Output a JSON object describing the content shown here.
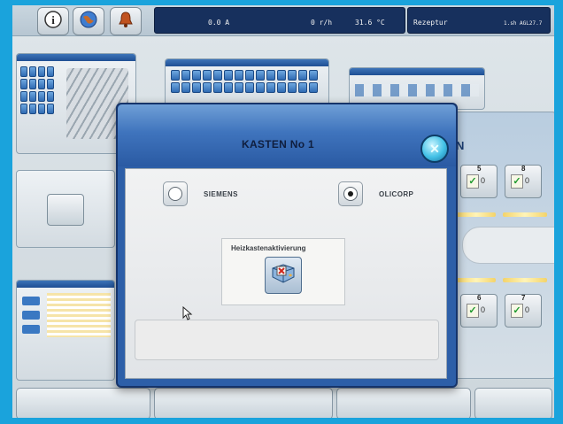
{
  "status_bar": {
    "field_1": "0.0 A",
    "field_2": "0 r/h",
    "field_3": "31.6 °C",
    "field_4": "Rezeptur",
    "field_5": "1.sh AGL27.7"
  },
  "dialog": {
    "title": "KASTEN No 1",
    "options": [
      {
        "label": "SIEMENS",
        "selected": false
      },
      {
        "label": "OLICORP",
        "selected": true
      }
    ],
    "heiz_label": "Heizkastenaktivierung",
    "message": ""
  },
  "background": {
    "partial_letter": "N",
    "tiles": [
      {
        "num": "5",
        "value": "0"
      },
      {
        "num": "8",
        "value": "0"
      },
      {
        "num": "6",
        "value": "0"
      },
      {
        "num": "7",
        "value": "0"
      }
    ]
  },
  "icons": {
    "info": "info-icon",
    "globe": "globe-icon",
    "bell": "bell-icon",
    "close": "close-icon",
    "heating": "heating-activation-icon",
    "cursor": "mouse-pointer-icon"
  },
  "colors": {
    "accent_blue": "#2d5fa8",
    "title_gradient_top": "#6f9fd6",
    "close_cyan": "#42c1e6",
    "check_green": "#1f9a2e"
  }
}
